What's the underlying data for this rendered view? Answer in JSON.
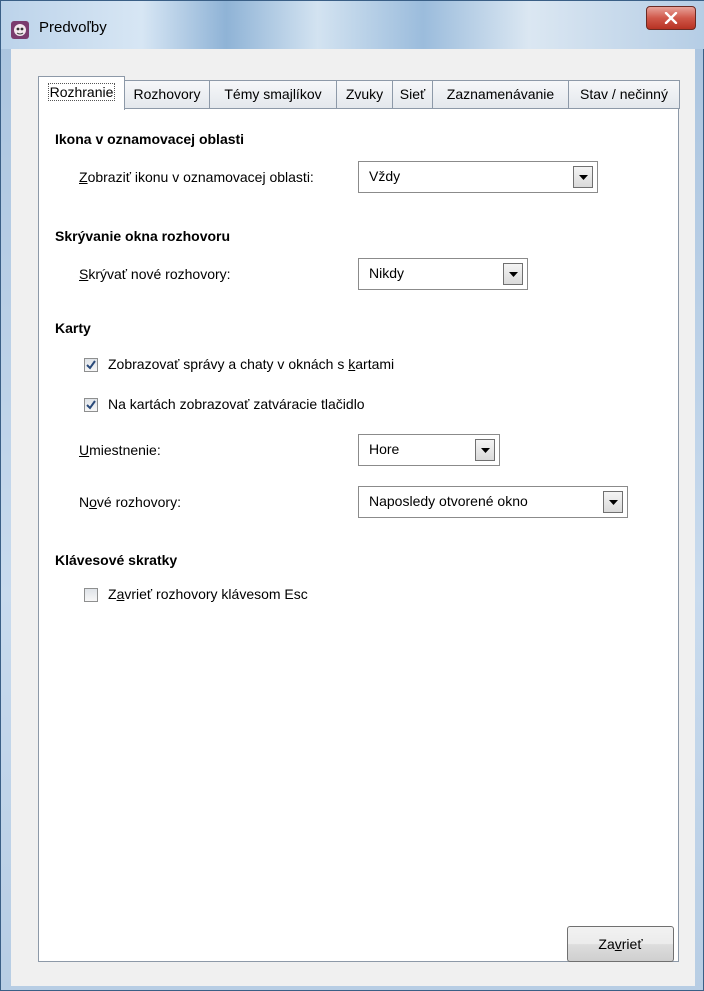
{
  "window": {
    "title": "Predvoľby"
  },
  "tabs": [
    {
      "label": "Rozhranie",
      "active": true
    },
    {
      "label": "Rozhovory",
      "active": false
    },
    {
      "label": "Témy smajlíkov",
      "active": false
    },
    {
      "label": "Zvuky",
      "active": false
    },
    {
      "label": "Sieť",
      "active": false
    },
    {
      "label": "Zaznamenávanie",
      "active": false
    },
    {
      "label": "Stav / nečinný",
      "active": false
    }
  ],
  "tray": {
    "title": "Ikona v oznamovacej oblasti",
    "label_key": "Z",
    "label_rest": "obraziť ikonu v oznamovacej oblasti:",
    "value": "Vždy"
  },
  "hiding": {
    "title": "Skrývanie okna rozhovoru",
    "label_key": "S",
    "label_rest": "krývať nové rozhovory:",
    "value": "Nikdy"
  },
  "tabs_section": {
    "title": "Karty",
    "check1_pre": "Zobrazovať správy a chaty v oknách s ",
    "check1_key": "k",
    "check1_post": "artami",
    "check1_checked": true,
    "check2_label": "Na kartách zobrazovať zatváracie tlačidlo",
    "check2_checked": true,
    "placement_key": "U",
    "placement_rest": "miestnenie:",
    "placement_value": "Hore",
    "new_pre": "N",
    "new_key": "o",
    "new_post": "vé rozhovory:",
    "new_value": "Naposledy otvorené okno"
  },
  "shortcuts": {
    "title": "Klávesové skratky",
    "check_pre": "Z",
    "check_key": "a",
    "check_post": "vrieť rozhovory klávesom Esc",
    "checked": false
  },
  "footer": {
    "close_pre": "Za",
    "close_key": "v",
    "close_post": "rieť"
  }
}
